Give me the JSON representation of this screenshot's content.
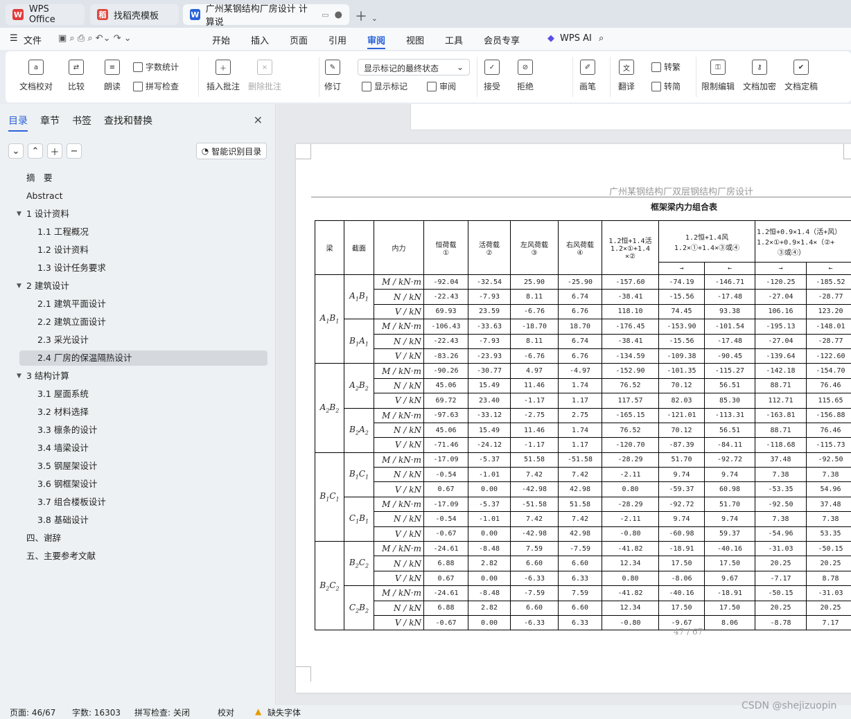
{
  "tabs": [
    {
      "label": "WPS Office",
      "logo": "W"
    },
    {
      "label": "找稻壳模板",
      "logo": "稻"
    },
    {
      "label": "广州某钢结构厂房设计 计算说",
      "logo": "W"
    }
  ],
  "menu": {
    "file": "文件",
    "items": [
      "开始",
      "插入",
      "页面",
      "引用",
      "审阅",
      "视图",
      "工具",
      "会员专享"
    ],
    "active": "审阅",
    "ai": "WPS AI"
  },
  "ribbon": {
    "doc_check": "文档校对",
    "compare": "比较",
    "read": "朗读",
    "word_count": "字数统计",
    "spell_check": "拼写检查",
    "insert_comment": "插入批注",
    "delete_comment": "删除批注",
    "revise": "修订",
    "markup_state": "显示标记的最终状态",
    "show_markup": "显示标记",
    "review": "审阅",
    "accept": "接受",
    "reject": "拒绝",
    "pen": "画笔",
    "translate": "翻译",
    "to_traditional": "转繁",
    "to_simplified": "转简",
    "restrict_edit": "限制编辑",
    "encrypt": "文档加密",
    "finalize": "文档定稿"
  },
  "sidebar": {
    "tabs": [
      "目录",
      "章节",
      "书签",
      "查找和替换"
    ],
    "smart_toc": "智能识别目录",
    "toc": [
      {
        "label": "摘　要",
        "level": 0
      },
      {
        "label": "Abstract",
        "level": 0
      },
      {
        "label": "1 设计资料",
        "level": 0,
        "expand": true
      },
      {
        "label": "1.1 工程概况",
        "level": 1
      },
      {
        "label": "1.2 设计资料",
        "level": 1
      },
      {
        "label": "1.3 设计任务要求",
        "level": 1
      },
      {
        "label": "2 建筑设计",
        "level": 0,
        "expand": true
      },
      {
        "label": "2.1 建筑平面设计",
        "level": 1
      },
      {
        "label": "2.2 建筑立面设计",
        "level": 1
      },
      {
        "label": "2.3  采光设计",
        "level": 1
      },
      {
        "label": "2.4  厂房的保温隔热设计",
        "level": 1,
        "selected": true
      },
      {
        "label": "3 结构计算",
        "level": 0,
        "expand": true
      },
      {
        "label": "3.1 屋面系统",
        "level": 1
      },
      {
        "label": "3.2 材料选择",
        "level": 1
      },
      {
        "label": "3.3 檩条的设计",
        "level": 1
      },
      {
        "label": "3.4  墙梁设计",
        "level": 1
      },
      {
        "label": "3.5  钢屋架设计",
        "level": 1
      },
      {
        "label": "3.6 钢框架设计",
        "level": 1
      },
      {
        "label": "3.7 组合楼板设计",
        "level": 1
      },
      {
        "label": "3.8 基础设计",
        "level": 1
      },
      {
        "label": "四、谢辞",
        "level": 0
      },
      {
        "label": "五、主要参考文献",
        "level": 0
      }
    ]
  },
  "document": {
    "header": "广州某钢结构厂双层钢结构厂房设计",
    "table_title": "框架梁内力组合表",
    "page_number": "47 / 67",
    "columns": [
      "梁",
      "截面",
      "内力",
      "恒荷载①",
      "活荷载②",
      "左风荷载③",
      "右风荷载④",
      "1.2恒+1.4活 1.2×①+1.4×②",
      "1.2恒+1.4风 1.2×①+1.4×③或④",
      "1.2恒+0.9×1.4（活+风） 1.2×①+0.9×1.4×（②+③或④）"
    ],
    "head": {
      "beam": "梁",
      "section": "截面",
      "force": "内力",
      "dead": "恒荷载",
      "dead_n": "①",
      "live": "活荷载",
      "live_n": "②",
      "lwind": "左风荷载",
      "lwind_n": "③",
      "rwind": "右风荷载",
      "rwind_n": "④",
      "c1a": "1.2恒+1.4活",
      "c1b": "1.2×①+1.4",
      "c1c": "×②",
      "c2a": "1.2恒+1.4风",
      "c2b": "1.2×①+1.4×③或④",
      "c3a": "1.2恒+0.9×1.4（活+风）",
      "c3b": "1.2×①+0.9×1.4×（②+",
      "c3c": "③或④）",
      "arrow_r": "→",
      "arrow_l": "←"
    },
    "groups": [
      {
        "beam": "A1B1",
        "sections": [
          {
            "name": "A1B1",
            "rows": [
              [
                "M / kN·m",
                "-92.04",
                "-32.54",
                "25.90",
                "-25.90",
                "-157.60",
                "-74.19",
                "-146.71",
                "-120.25",
                "-185.52"
              ],
              [
                "N / kN",
                "-22.43",
                "-7.93",
                "8.11",
                "6.74",
                "-38.41",
                "-15.56",
                "-17.48",
                "-27.04",
                "-28.77"
              ],
              [
                "V / kN",
                "69.93",
                "23.59",
                "-6.76",
                "6.76",
                "118.10",
                "74.45",
                "93.38",
                "106.16",
                "123.20"
              ]
            ]
          },
          {
            "name": "B1A1",
            "rows": [
              [
                "M / kN·m",
                "-106.43",
                "-33.63",
                "-18.70",
                "18.70",
                "-176.45",
                "-153.90",
                "-101.54",
                "-195.13",
                "-148.01"
              ],
              [
                "N / kN",
                "-22.43",
                "-7.93",
                "8.11",
                "6.74",
                "-38.41",
                "-15.56",
                "-17.48",
                "-27.04",
                "-28.77"
              ],
              [
                "V / kN",
                "-83.26",
                "-23.93",
                "-6.76",
                "6.76",
                "-134.59",
                "-109.38",
                "-90.45",
                "-139.64",
                "-122.60"
              ]
            ]
          }
        ]
      },
      {
        "beam": "A2B2",
        "sections": [
          {
            "name": "A2B2",
            "rows": [
              [
                "M / kN·m",
                "-90.26",
                "-30.77",
                "4.97",
                "-4.97",
                "-152.90",
                "-101.35",
                "-115.27",
                "-142.18",
                "-154.70"
              ],
              [
                "N / kN",
                "45.06",
                "15.49",
                "11.46",
                "1.74",
                "76.52",
                "70.12",
                "56.51",
                "88.71",
                "76.46"
              ],
              [
                "V / kN",
                "69.72",
                "23.40",
                "-1.17",
                "1.17",
                "117.57",
                "82.03",
                "85.30",
                "112.71",
                "115.65"
              ]
            ]
          },
          {
            "name": "B2A2",
            "rows": [
              [
                "M / kN·m",
                "-97.63",
                "-33.12",
                "-2.75",
                "2.75",
                "-165.15",
                "-121.01",
                "-113.31",
                "-163.81",
                "-156.88"
              ],
              [
                "N / kN",
                "45.06",
                "15.49",
                "11.46",
                "1.74",
                "76.52",
                "70.12",
                "56.51",
                "88.71",
                "76.46"
              ],
              [
                "V / kN",
                "-71.46",
                "-24.12",
                "-1.17",
                "1.17",
                "-120.70",
                "-87.39",
                "-84.11",
                "-118.68",
                "-115.73"
              ]
            ]
          }
        ]
      },
      {
        "beam": "B1C1",
        "sections": [
          {
            "name": "B1C1",
            "rows": [
              [
                "M / kN·m",
                "-17.09",
                "-5.37",
                "51.58",
                "-51.58",
                "-28.29",
                "51.70",
                "-92.72",
                "37.48",
                "-92.50"
              ],
              [
                "N / kN",
                "-0.54",
                "-1.01",
                "7.42",
                "7.42",
                "-2.11",
                "9.74",
                "9.74",
                "7.38",
                "7.38"
              ],
              [
                "V / kN",
                "0.67",
                "0.00",
                "-42.98",
                "42.98",
                "0.80",
                "-59.37",
                "60.98",
                "-53.35",
                "54.96"
              ]
            ]
          },
          {
            "name": "C1B1",
            "rows": [
              [
                "M / kN·m",
                "-17.09",
                "-5.37",
                "-51.58",
                "51.58",
                "-28.29",
                "-92.72",
                "51.70",
                "-92.50",
                "37.48"
              ],
              [
                "N / kN",
                "-0.54",
                "-1.01",
                "7.42",
                "7.42",
                "-2.11",
                "9.74",
                "9.74",
                "7.38",
                "7.38"
              ],
              [
                "V / kN",
                "-0.67",
                "0.00",
                "-42.98",
                "42.98",
                "-0.80",
                "-60.98",
                "59.37",
                "-54.96",
                "53.35"
              ]
            ]
          }
        ]
      },
      {
        "beam": "B2C2",
        "sections": [
          {
            "name": "B2C2",
            "rows": [
              [
                "M / kN·m",
                "-24.61",
                "-8.48",
                "7.59",
                "-7.59",
                "-41.82",
                "-18.91",
                "-40.16",
                "-31.03",
                "-50.15"
              ],
              [
                "N / kN",
                "6.88",
                "2.82",
                "6.60",
                "6.60",
                "12.34",
                "17.50",
                "17.50",
                "20.25",
                "20.25"
              ],
              [
                "V / kN",
                "0.67",
                "0.00",
                "-6.33",
                "6.33",
                "0.80",
                "-8.06",
                "9.67",
                "-7.17",
                "8.78"
              ]
            ]
          },
          {
            "name": "C2B2",
            "rows": [
              [
                "M / kN·m",
                "-24.61",
                "-8.48",
                "-7.59",
                "7.59",
                "-41.82",
                "-40.16",
                "-18.91",
                "-50.15",
                "-31.03"
              ],
              [
                "N / kN",
                "6.88",
                "2.82",
                "6.60",
                "6.60",
                "12.34",
                "17.50",
                "17.50",
                "20.25",
                "20.25"
              ],
              [
                "V / kN",
                "-0.67",
                "0.00",
                "-6.33",
                "6.33",
                "-0.80",
                "-9.67",
                "8.06",
                "-8.78",
                "7.17"
              ]
            ]
          }
        ]
      }
    ]
  },
  "status": {
    "page": "页面: 46/67",
    "words": "字数: 16303",
    "spell": "拼写检查: 关闭",
    "proof": "校对",
    "missing_font": "缺失字体"
  },
  "watermark": "CSDN @shejizuopin"
}
